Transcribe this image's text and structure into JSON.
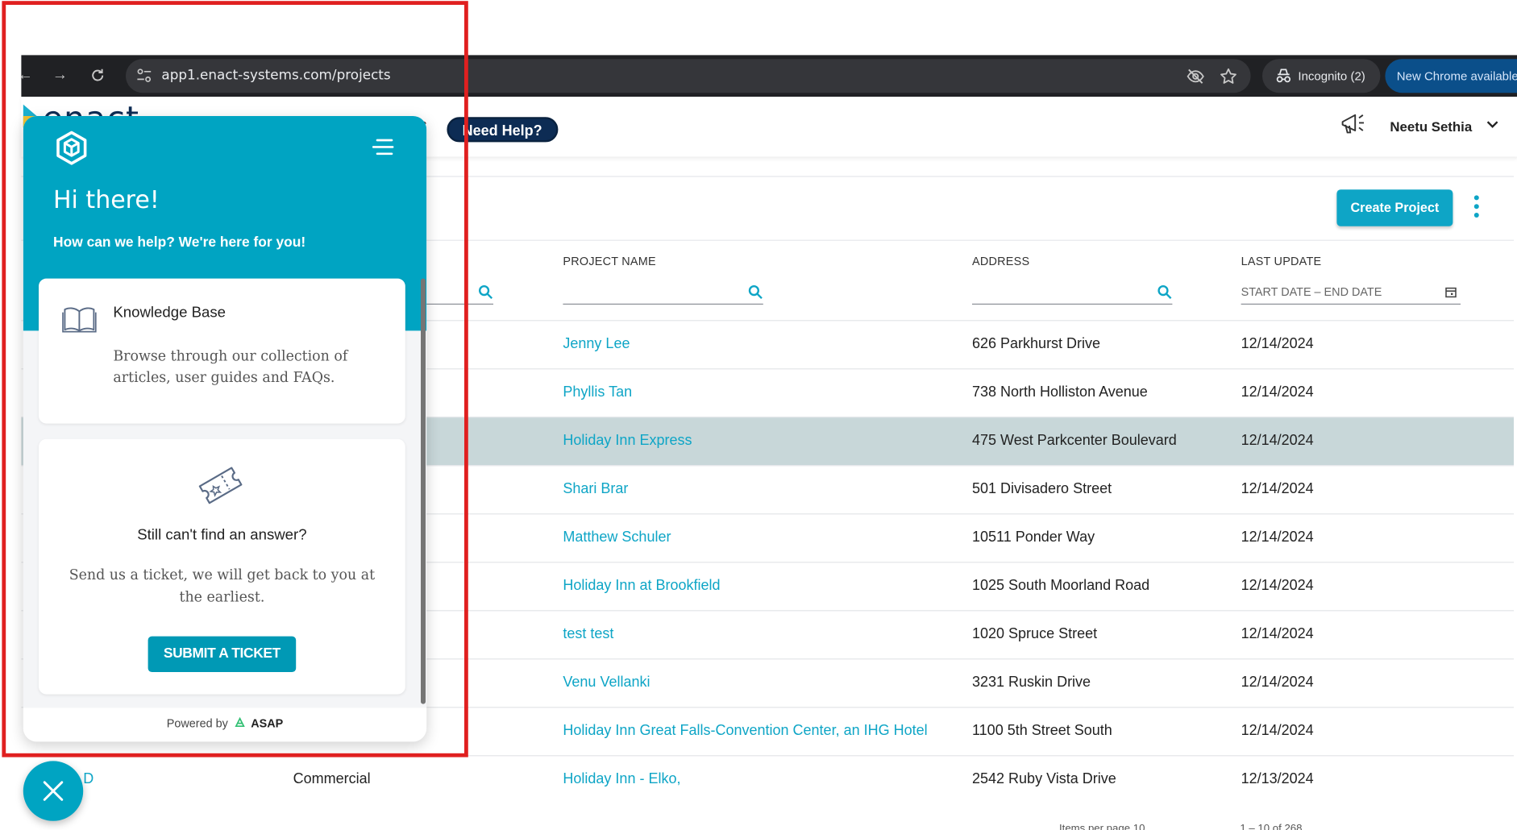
{
  "browser": {
    "url": "app1.enact-systems.com/projects",
    "incognito_label": "Incognito (2)",
    "new_chrome_label": "New Chrome available"
  },
  "header": {
    "logo_text": "enact",
    "page_title_fragment": "s",
    "need_help_label": "Need Help?",
    "user_name": "Neetu Sethia"
  },
  "toolbar": {
    "create_project_label": "Create Project"
  },
  "table": {
    "columns": {
      "project_name": "PROJECT NAME",
      "address": "ADDRESS",
      "last_update": "LAST UPDATE"
    },
    "date_filter_placeholder": "START DATE – END DATE",
    "rows": [
      {
        "project_name": "Jenny Lee",
        "address": "626 Parkhurst Drive",
        "last_update": "12/14/2024"
      },
      {
        "project_name": "Phyllis Tan",
        "address": "738 North Holliston Avenue",
        "last_update": "12/14/2024"
      },
      {
        "project_name": "Holiday Inn Express",
        "address": "475 West Parkcenter Boulevard",
        "last_update": "12/14/2024"
      },
      {
        "project_name": "Shari Brar",
        "address": "501 Divisadero Street",
        "last_update": "12/14/2024"
      },
      {
        "project_name": "Matthew Schuler",
        "address": "10511 Ponder Way",
        "last_update": "12/14/2024"
      },
      {
        "project_name": "Holiday Inn at Brookfield",
        "address": "1025 South Moorland Road",
        "last_update": "12/14/2024"
      },
      {
        "project_name": "test test",
        "address": "1020 Spruce Street",
        "last_update": "12/14/2024"
      },
      {
        "project_name": "Venu Vellanki",
        "address": "3231 Ruskin Drive",
        "last_update": "12/14/2024"
      },
      {
        "project_name": "Holiday Inn Great Falls-Convention Center, an IHG Hotel",
        "address": "1100 5th Street South",
        "last_update": "12/14/2024"
      },
      {
        "project_id_fragment": "D",
        "type": "Commercial",
        "project_name": "Holiday Inn - Elko,",
        "address": "2542 Ruby Vista Drive",
        "last_update": "12/13/2024"
      }
    ],
    "footer": {
      "items_per_page_label": "Items per page",
      "items_per_page_value": "10",
      "range_label": "1 – 10 of 268"
    }
  },
  "help_widget": {
    "greeting": "Hi there!",
    "subtitle": "How can we help? We're here for you!",
    "knowledge_base": {
      "title": "Knowledge Base",
      "description": "Browse through our collection of articles, user guides and FAQs."
    },
    "ticket": {
      "title": "Still can't find an answer?",
      "description": "Send us a ticket, we will get back to you at the earliest.",
      "button_label": "SUBMIT A TICKET"
    },
    "footer": {
      "powered_by": "Powered by",
      "brand": "ASAP"
    }
  },
  "colors": {
    "accent": "#00a4c2",
    "link": "#0ea5c6",
    "highlight_row": "#c8d7d9",
    "navy": "#0d2c54",
    "annotation_box": "#e02020"
  }
}
